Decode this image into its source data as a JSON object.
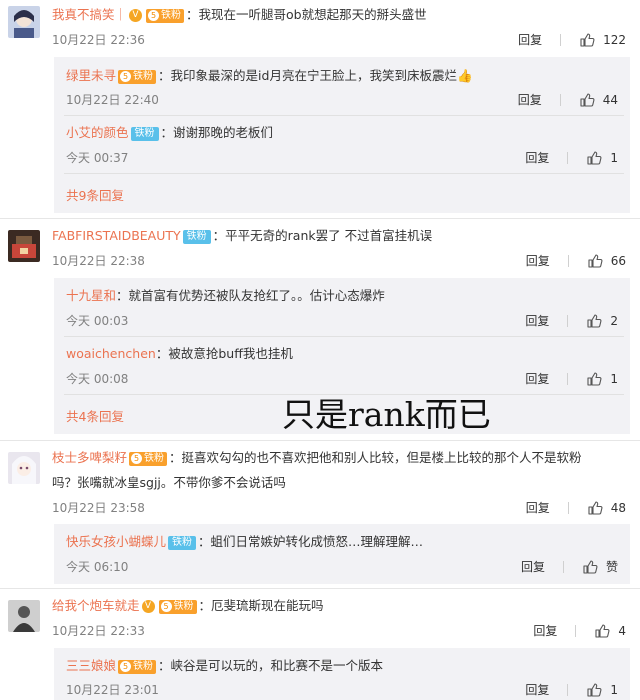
{
  "comments": [
    {
      "user": "我真不搞笑｜",
      "v_badge": "V",
      "fan_badge": "铁粉",
      "fan_level": "5",
      "text": "我现在一听腿哥ob就想起那天的掰头盛世",
      "time": "10月22日 22:36",
      "reply": "回复",
      "likes": "122",
      "sub_replies": [
        {
          "user": "绿里未寻",
          "fan_badge": "铁粉",
          "fan_level": "5",
          "text": "我印象最深的是id月亮在宁王脸上，我笑到床板震烂",
          "emoji": "👍",
          "time": "10月22日 22:40",
          "reply": "回复",
          "likes": "44"
        },
        {
          "user": "小艾的颜色",
          "iron_badge": "铁粉",
          "text": "谢谢那晚的老板们",
          "time": "今天 00:37",
          "reply": "回复",
          "likes": "1"
        }
      ],
      "total": "共9条回复"
    },
    {
      "user": "FABFIRSTAIDBEAUTY",
      "iron_badge": "铁粉",
      "text": "平平无奇的rank罢了 不过首富挂机误",
      "time": "10月22日 22:38",
      "reply": "回复",
      "likes": "66",
      "sub_replies": [
        {
          "user": "十九星和",
          "text": "就首富有优势还被队友抢红了。。估计心态爆炸",
          "time": "今天 00:03",
          "reply": "回复",
          "likes": "2"
        },
        {
          "user": "woaichenchen",
          "text": "被故意抢buff我也挂机",
          "time": "今天 00:08",
          "reply": "回复",
          "likes": "1"
        }
      ],
      "total": "共4条回复"
    },
    {
      "user": "枝士多啤梨籽",
      "fan_badge": "铁粉",
      "fan_level": "5",
      "text_line1": "挺喜欢勾勾的也不喜欢把他和别人比较，但是楼上比较的那个人不是软粉",
      "text_line2": "吗？张嘴就冰皇sgjj。不带你爹不会说话吗",
      "time": "10月22日 23:58",
      "reply": "回复",
      "likes": "48",
      "sub_replies": [
        {
          "user": "快乐女孩小蝴蝶儿",
          "iron_badge": "铁粉",
          "text": "蛆们日常嫉妒转化成愤怒…理解理解…",
          "time": "今天 06:10",
          "reply": "回复",
          "likes": "赞"
        }
      ]
    },
    {
      "user": "给我个炮车就走",
      "v_badge": "V",
      "fan_badge": "铁粉",
      "fan_level": "5",
      "text": "厄斐琉斯现在能玩吗",
      "time": "10月22日 22:33",
      "reply": "回复",
      "likes": "4",
      "sub_replies": [
        {
          "user": "三三娘娘",
          "fan_badge": "铁粉",
          "fan_level": "5",
          "text": "峡谷是可以玩的，和比赛不是一个版本",
          "time": "10月22日 23:01",
          "reply": "回复",
          "likes": "1"
        }
      ]
    }
  ],
  "colon": "：",
  "overlay_caption": "只是rank而已"
}
